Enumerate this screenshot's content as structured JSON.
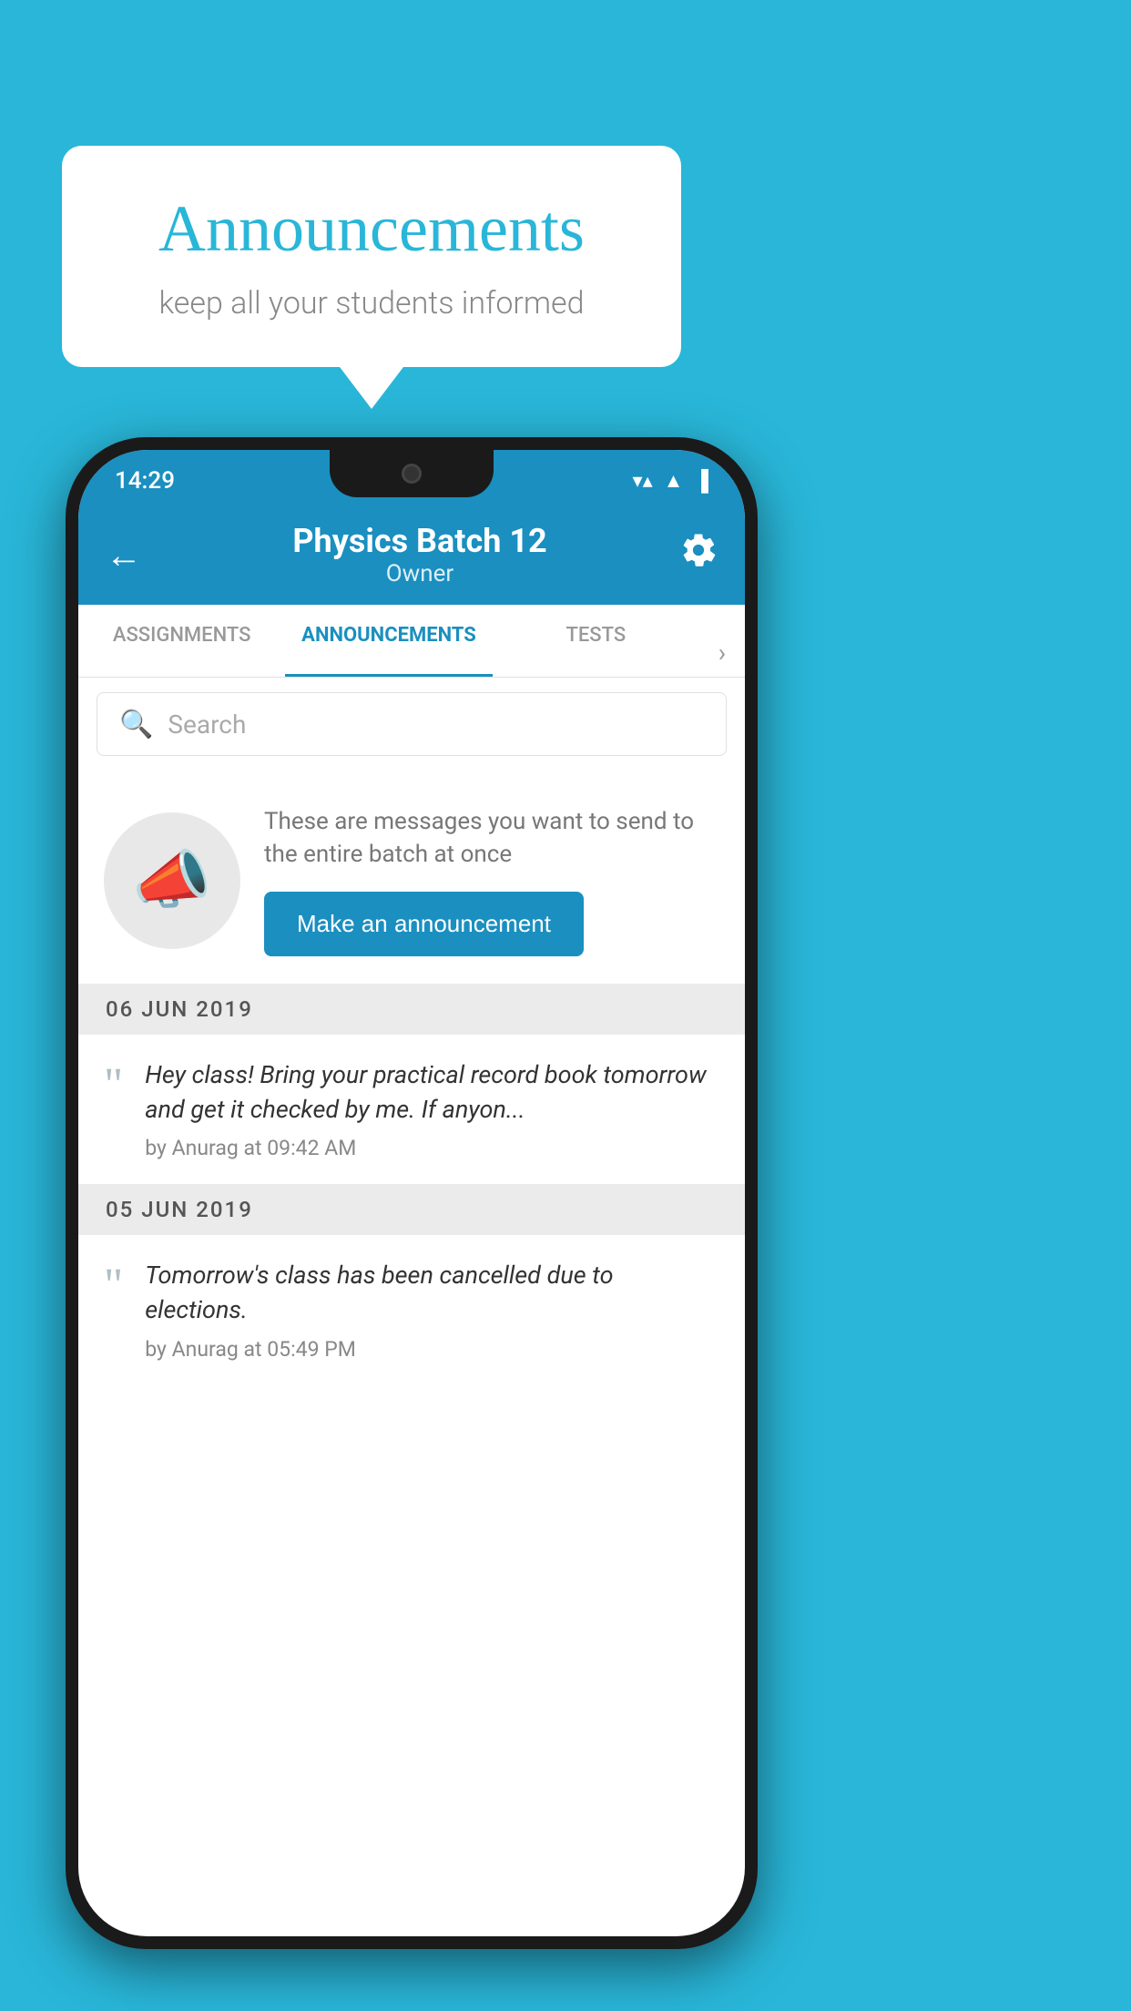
{
  "background": {
    "color": "#29b6d8"
  },
  "speech_bubble": {
    "title": "Announcements",
    "subtitle": "keep all your students informed"
  },
  "phone": {
    "status_bar": {
      "time": "14:29",
      "icons": [
        "wifi",
        "signal",
        "battery"
      ]
    },
    "app_bar": {
      "title": "Physics Batch 12",
      "subtitle": "Owner",
      "back_label": "←",
      "settings_label": "⚙"
    },
    "tabs": [
      {
        "label": "ASSIGNMENTS",
        "active": false
      },
      {
        "label": "ANNOUNCEMENTS",
        "active": true
      },
      {
        "label": "TESTS",
        "active": false
      }
    ],
    "search": {
      "placeholder": "Search"
    },
    "promo": {
      "description": "These are messages you want to send to the entire batch at once",
      "button_label": "Make an announcement"
    },
    "announcements": [
      {
        "date": "06  JUN  2019",
        "text": "Hey class! Bring your practical record book tomorrow and get it checked by me. If anyon...",
        "meta": "by Anurag at 09:42 AM"
      },
      {
        "date": "05  JUN  2019",
        "text": "Tomorrow's class has been cancelled due to elections.",
        "meta": "by Anurag at 05:49 PM"
      }
    ]
  }
}
